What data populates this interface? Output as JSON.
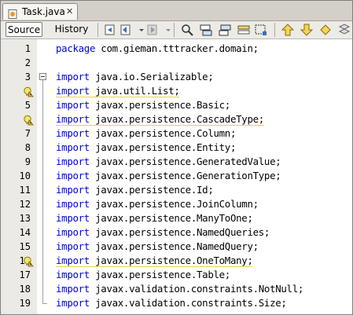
{
  "tab": {
    "title": "Task.java",
    "close": "✕",
    "icon": "java-file-icon"
  },
  "toolbar": {
    "source_label": "Source",
    "history_label": "History",
    "icons": [
      "last-edit-icon",
      "back-icon",
      "forward-icon",
      "find-icon",
      "find-previous-icon",
      "find-next-icon",
      "toggle-highlight-icon",
      "toggle-rect-selection-icon",
      "previous-bookmark-icon",
      "next-bookmark-icon",
      "toggle-bookmark-icon"
    ]
  },
  "editor": {
    "lines": [
      {
        "num": "1",
        "kw": "package",
        "rest": " com.gieman.tttracker.domain;",
        "warn": false,
        "fold": ""
      },
      {
        "num": "2",
        "kw": "",
        "rest": "",
        "warn": false,
        "fold": ""
      },
      {
        "num": "3",
        "kw": "import",
        "rest": " java.io.Serializable;",
        "warn": false,
        "fold": "start"
      },
      {
        "num": "4",
        "kw": "import",
        "rest": " java.util.List;",
        "warn": true,
        "fold": ""
      },
      {
        "num": "5",
        "kw": "import",
        "rest": " javax.persistence.Basic;",
        "warn": false,
        "fold": ""
      },
      {
        "num": "6",
        "kw": "import",
        "rest": " javax.persistence.CascadeType;",
        "warn": true,
        "fold": ""
      },
      {
        "num": "7",
        "kw": "import",
        "rest": " javax.persistence.Column;",
        "warn": false,
        "fold": ""
      },
      {
        "num": "8",
        "kw": "import",
        "rest": " javax.persistence.Entity;",
        "warn": false,
        "fold": ""
      },
      {
        "num": "9",
        "kw": "import",
        "rest": " javax.persistence.GeneratedValue;",
        "warn": false,
        "fold": ""
      },
      {
        "num": "10",
        "kw": "import",
        "rest": " javax.persistence.GenerationType;",
        "warn": false,
        "fold": ""
      },
      {
        "num": "11",
        "kw": "import",
        "rest": " javax.persistence.Id;",
        "warn": false,
        "fold": ""
      },
      {
        "num": "12",
        "kw": "import",
        "rest": " javax.persistence.JoinColumn;",
        "warn": false,
        "fold": ""
      },
      {
        "num": "13",
        "kw": "import",
        "rest": " javax.persistence.ManyToOne;",
        "warn": false,
        "fold": ""
      },
      {
        "num": "14",
        "kw": "import",
        "rest": " javax.persistence.NamedQueries;",
        "warn": false,
        "fold": ""
      },
      {
        "num": "15",
        "kw": "import",
        "rest": " javax.persistence.NamedQuery;",
        "warn": false,
        "fold": ""
      },
      {
        "num": "16",
        "kw": "import",
        "rest": " javax.persistence.OneToMany;",
        "warn": true,
        "fold": ""
      },
      {
        "num": "17",
        "kw": "import",
        "rest": " javax.persistence.Table;",
        "warn": false,
        "fold": ""
      },
      {
        "num": "18",
        "kw": "import",
        "rest": " javax.validation.constraints.NotNull;",
        "warn": false,
        "fold": ""
      },
      {
        "num": "19",
        "kw": "import",
        "rest": " javax.validation.constraints.Size;",
        "warn": false,
        "fold": "end"
      }
    ],
    "colors": {
      "keyword": "#0000e6",
      "warning_underline": "#e8d34c",
      "gutter": "#eceae5"
    },
    "hint_icon": "warning-bulb-icon"
  }
}
